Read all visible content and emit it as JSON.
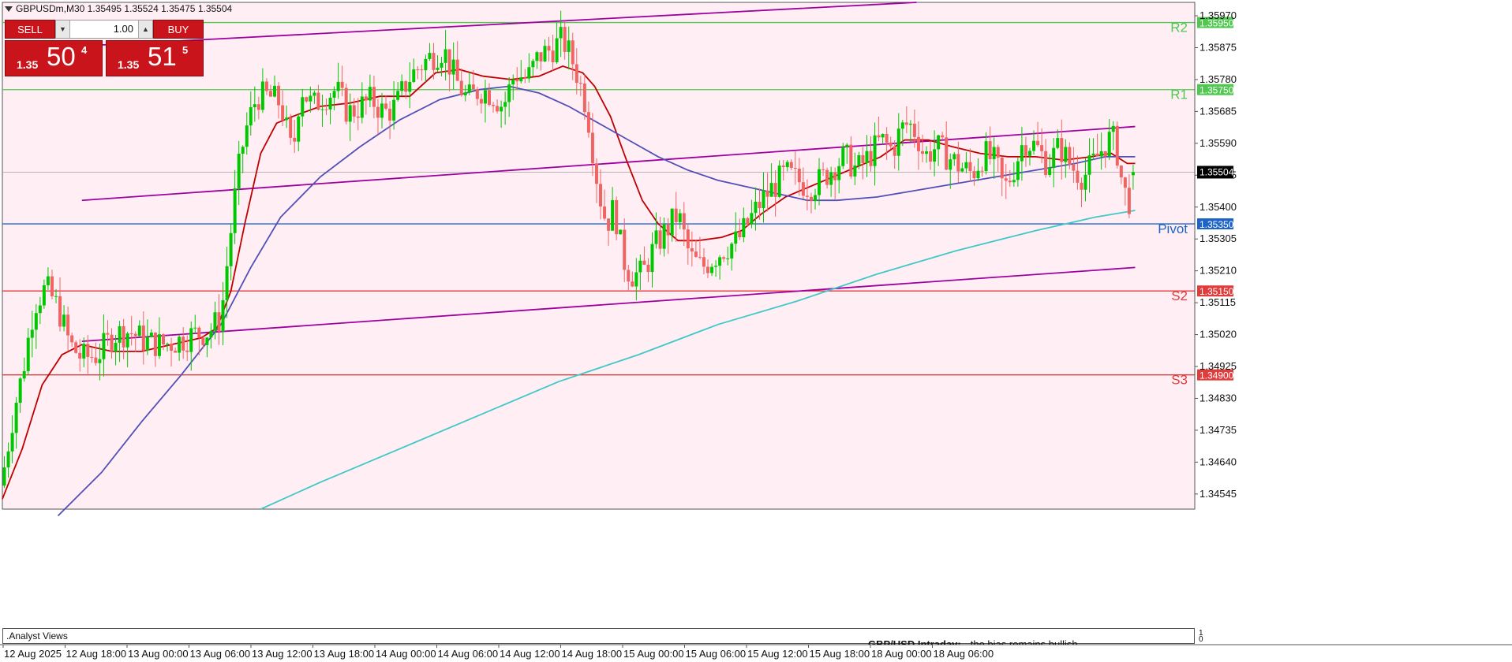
{
  "symbol": {
    "header": "GBPUSDm,M30  1.35495 1.35524 1.35475 1.35504"
  },
  "trade_panel": {
    "sell_label": "SELL",
    "buy_label": "BUY",
    "lot": "1.00",
    "bid_prefix": "1.35",
    "bid_big": "50",
    "bid_sup": "4",
    "ask_prefix": "1.35",
    "ask_big": "51",
    "ask_sup": "5"
  },
  "bottom_panel": {
    "title": ".Analyst Views",
    "headline": "GBP/USD Intraday:",
    "text": "the bias remains bullish",
    "scale_top": "1",
    "scale_bottom": "0"
  },
  "colors": {
    "background": "#ffeff4",
    "bull": "#00c800",
    "bear": "#f06464",
    "ma_fast": "#c00000",
    "ma_mid": "#5050b8",
    "ma_slow": "#40c8c8",
    "channel": "#a000a0",
    "resistance": "#50c850",
    "pivot": "#1e64c8",
    "support": "#e03c3c"
  },
  "chart_data": {
    "type": "candlestick",
    "symbol": "GBPUSDm",
    "timeframe": "M30",
    "ohlc_current": {
      "open": 1.35495,
      "high": 1.35524,
      "low": 1.35475,
      "close": 1.35504
    },
    "current_price": "1.35504",
    "ylim": [
      1.345,
      1.3601
    ],
    "y_ticks": [
      "1.35970",
      "1.35875",
      "1.35780",
      "1.35685",
      "1.35590",
      "1.35495",
      "1.35400",
      "1.35305",
      "1.35210",
      "1.35115",
      "1.35020",
      "1.34925",
      "1.34830",
      "1.34735",
      "1.34640",
      "1.34545"
    ],
    "x_labels": [
      "12 Aug 2025",
      "12 Aug 18:00",
      "13 Aug 00:00",
      "13 Aug 06:00",
      "13 Aug 12:00",
      "13 Aug 18:00",
      "14 Aug 00:00",
      "14 Aug 06:00",
      "14 Aug 12:00",
      "14 Aug 18:00",
      "15 Aug 00:00",
      "15 Aug 06:00",
      "15 Aug 12:00",
      "15 Aug 18:00",
      "18 Aug 00:00",
      "18 Aug 06:00"
    ],
    "levels": [
      {
        "name": "R2",
        "value": "1.35950",
        "kind": "resistance"
      },
      {
        "name": "R1",
        "value": "1.35750",
        "kind": "resistance"
      },
      {
        "name": "Pivot",
        "value": "1.35350",
        "kind": "pivot"
      },
      {
        "name": "S2",
        "value": "1.35150",
        "kind": "support"
      },
      {
        "name": "S3",
        "value": "1.34900",
        "kind": "support"
      }
    ],
    "close_path": [
      [
        0,
        1.3459
      ],
      [
        6,
        1.348
      ],
      [
        10,
        1.349
      ],
      [
        16,
        1.3511
      ],
      [
        22,
        1.3516
      ],
      [
        28,
        1.351
      ],
      [
        34,
        1.3499
      ],
      [
        40,
        1.3495
      ],
      [
        48,
        1.3496
      ],
      [
        56,
        1.3502
      ],
      [
        64,
        1.3503
      ],
      [
        72,
        1.35
      ],
      [
        80,
        1.3499
      ],
      [
        88,
        1.35
      ],
      [
        96,
        1.3502
      ],
      [
        104,
        1.3503
      ],
      [
        110,
        1.3507
      ],
      [
        114,
        1.3528
      ],
      [
        118,
        1.3548
      ],
      [
        122,
        1.3562
      ],
      [
        128,
        1.3573
      ],
      [
        134,
        1.3573
      ],
      [
        140,
        1.3571
      ],
      [
        146,
        1.3555
      ],
      [
        150,
        1.3576
      ],
      [
        156,
        1.357
      ],
      [
        162,
        1.3573
      ],
      [
        168,
        1.3575
      ],
      [
        174,
        1.3568
      ],
      [
        180,
        1.357
      ],
      [
        186,
        1.3572
      ],
      [
        192,
        1.3568
      ],
      [
        198,
        1.357
      ],
      [
        204,
        1.3578
      ],
      [
        210,
        1.3582
      ],
      [
        216,
        1.3585
      ],
      [
        222,
        1.3587
      ],
      [
        228,
        1.3578
      ],
      [
        234,
        1.3572
      ],
      [
        240,
        1.3575
      ],
      [
        246,
        1.3574
      ],
      [
        252,
        1.357
      ],
      [
        258,
        1.358
      ],
      [
        264,
        1.3578
      ],
      [
        270,
        1.3585
      ],
      [
        276,
        1.3587
      ],
      [
        282,
        1.359
      ],
      [
        288,
        1.3582
      ],
      [
        294,
        1.357
      ],
      [
        300,
        1.3545
      ],
      [
        304,
        1.3535
      ],
      [
        308,
        1.354
      ],
      [
        312,
        1.3525
      ],
      [
        316,
        1.352
      ],
      [
        322,
        1.352
      ],
      [
        328,
        1.3528
      ],
      [
        334,
        1.3533
      ],
      [
        340,
        1.3538
      ],
      [
        346,
        1.3525
      ],
      [
        352,
        1.3522
      ],
      [
        358,
        1.3525
      ],
      [
        364,
        1.3528
      ],
      [
        370,
        1.353
      ],
      [
        376,
        1.3536
      ],
      [
        382,
        1.3542
      ],
      [
        388,
        1.3546
      ],
      [
        394,
        1.355
      ],
      [
        400,
        1.3548
      ],
      [
        406,
        1.3546
      ],
      [
        412,
        1.3548
      ],
      [
        418,
        1.3552
      ],
      [
        424,
        1.3555
      ],
      [
        430,
        1.3551
      ],
      [
        436,
        1.3555
      ],
      [
        442,
        1.356
      ],
      [
        448,
        1.3557
      ],
      [
        452,
        1.3563
      ],
      [
        456,
        1.3565
      ],
      [
        460,
        1.3562
      ],
      [
        464,
        1.3555
      ],
      [
        470,
        1.3558
      ],
      [
        476,
        1.3555
      ],
      [
        482,
        1.3552
      ],
      [
        488,
        1.355
      ],
      [
        494,
        1.3556
      ],
      [
        500,
        1.3553
      ],
      [
        504,
        1.3545
      ],
      [
        508,
        1.355
      ],
      [
        514,
        1.356
      ],
      [
        520,
        1.3558
      ],
      [
        526,
        1.3553
      ],
      [
        532,
        1.3558
      ],
      [
        538,
        1.3552
      ],
      [
        544,
        1.3549
      ],
      [
        550,
        1.3554
      ],
      [
        556,
        1.356
      ],
      [
        560,
        1.356
      ],
      [
        564,
        1.3545
      ],
      [
        567,
        1.3542
      ],
      [
        570,
        1.355
      ]
    ],
    "series": [
      {
        "name": "",
        "kind": "ma_fast",
        "points": [
          [
            0,
            1.3453
          ],
          [
            10,
            1.3468
          ],
          [
            20,
            1.3487
          ],
          [
            30,
            1.3496
          ],
          [
            40,
            1.3499
          ],
          [
            55,
            1.3497
          ],
          [
            70,
            1.3497
          ],
          [
            85,
            1.3499
          ],
          [
            100,
            1.3501
          ],
          [
            108,
            1.3504
          ],
          [
            115,
            1.3515
          ],
          [
            122,
            1.3535
          ],
          [
            130,
            1.3556
          ],
          [
            138,
            1.3565
          ],
          [
            146,
            1.3567
          ],
          [
            160,
            1.357
          ],
          [
            175,
            1.3571
          ],
          [
            190,
            1.3573
          ],
          [
            205,
            1.3573
          ],
          [
            218,
            1.358
          ],
          [
            230,
            1.3581
          ],
          [
            242,
            1.3579
          ],
          [
            256,
            1.3578
          ],
          [
            270,
            1.3579
          ],
          [
            282,
            1.3582
          ],
          [
            292,
            1.358
          ],
          [
            298,
            1.3576
          ],
          [
            306,
            1.3567
          ],
          [
            314,
            1.3554
          ],
          [
            322,
            1.3542
          ],
          [
            330,
            1.3535
          ],
          [
            340,
            1.353
          ],
          [
            350,
            1.353
          ],
          [
            362,
            1.3531
          ],
          [
            372,
            1.3533
          ],
          [
            382,
            1.3538
          ],
          [
            394,
            1.3543
          ],
          [
            406,
            1.3546
          ],
          [
            418,
            1.3549
          ],
          [
            430,
            1.3552
          ],
          [
            442,
            1.3555
          ],
          [
            454,
            1.356
          ],
          [
            466,
            1.356
          ],
          [
            478,
            1.3558
          ],
          [
            492,
            1.3556
          ],
          [
            506,
            1.3555
          ],
          [
            520,
            1.3555
          ],
          [
            534,
            1.3554
          ],
          [
            548,
            1.3555
          ],
          [
            558,
            1.3556
          ],
          [
            566,
            1.3553
          ],
          [
            570,
            1.3553
          ]
        ]
      },
      {
        "name": "",
        "kind": "ma_mid",
        "points": [
          [
            28,
            1.3448
          ],
          [
            50,
            1.3461
          ],
          [
            70,
            1.3476
          ],
          [
            90,
            1.349
          ],
          [
            110,
            1.3505
          ],
          [
            125,
            1.3522
          ],
          [
            140,
            1.3537
          ],
          [
            160,
            1.3549
          ],
          [
            180,
            1.3558
          ],
          [
            200,
            1.3566
          ],
          [
            220,
            1.3572
          ],
          [
            240,
            1.3575
          ],
          [
            255,
            1.3576
          ],
          [
            270,
            1.3574
          ],
          [
            285,
            1.357
          ],
          [
            300,
            1.3565
          ],
          [
            315,
            1.356
          ],
          [
            330,
            1.3555
          ],
          [
            345,
            1.3551
          ],
          [
            360,
            1.3548
          ],
          [
            375,
            1.3546
          ],
          [
            390,
            1.3544
          ],
          [
            405,
            1.3542
          ],
          [
            420,
            1.3542
          ],
          [
            440,
            1.3543
          ],
          [
            460,
            1.3545
          ],
          [
            480,
            1.3547
          ],
          [
            500,
            1.3549
          ],
          [
            520,
            1.3551
          ],
          [
            540,
            1.3553
          ],
          [
            555,
            1.3555
          ],
          [
            570,
            1.3555
          ]
        ]
      },
      {
        "name": "",
        "kind": "ma_slow",
        "points": [
          [
            130,
            1.345
          ],
          [
            160,
            1.3458
          ],
          [
            200,
            1.3468
          ],
          [
            240,
            1.3478
          ],
          [
            280,
            1.3488
          ],
          [
            320,
            1.3496
          ],
          [
            360,
            1.3505
          ],
          [
            400,
            1.3512
          ],
          [
            440,
            1.352
          ],
          [
            480,
            1.3527
          ],
          [
            520,
            1.3533
          ],
          [
            550,
            1.3537
          ],
          [
            570,
            1.3539
          ]
        ]
      }
    ],
    "channels": [
      {
        "kind": "channel",
        "from": [
          40,
          1.3588
        ],
        "to": [
          460,
          1.3601
        ]
      },
      {
        "kind": "channel",
        "from": [
          40,
          1.3542
        ],
        "to": [
          570,
          1.3564
        ]
      },
      {
        "kind": "channel",
        "from": [
          40,
          1.35
        ],
        "to": [
          570,
          1.3522
        ]
      }
    ],
    "x_range": [
      0,
      600
    ],
    "grid": false
  }
}
